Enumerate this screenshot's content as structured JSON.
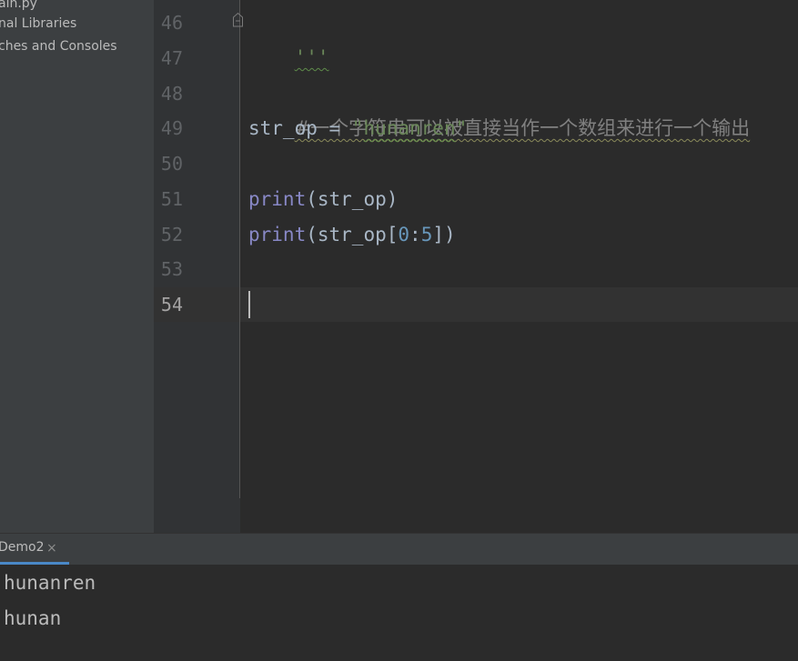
{
  "project_tree": {
    "items": [
      {
        "label": "ain.py"
      },
      {
        "label": "nal Libraries"
      },
      {
        "label": "ches and Consoles"
      }
    ]
  },
  "editor": {
    "line_numbers": [
      "46",
      "47",
      "48",
      "49",
      "50",
      "51",
      "52",
      "53",
      "54"
    ],
    "current_line": "54",
    "lines": {
      "l46": {
        "docstring": "'''"
      },
      "l48": {
        "comment": "#一个字符串可以被直接当作一个数组来进行一个输出"
      },
      "l49": {
        "var": "str_op",
        "op": " = ",
        "string": "\"hunanren\""
      },
      "l51": {
        "func": "print",
        "open": "(",
        "arg": "str_op",
        "close": ")"
      },
      "l52": {
        "func": "print",
        "open": "(",
        "arg": "str_op[",
        "num1": "0",
        "colon": ":",
        "num2": "5",
        "close": "])"
      }
    }
  },
  "run_window": {
    "tab_label": "Demo2",
    "close_glyph": "×",
    "output": [
      "hunanren",
      "hunan"
    ]
  },
  "colors": {
    "keyword": "#8888c6",
    "string": "#6a8759",
    "number": "#6897bb",
    "comment": "#808080",
    "accent": "#4a88c7"
  },
  "icons": {
    "fold": "fold-marker-icon",
    "close": "close-icon"
  }
}
